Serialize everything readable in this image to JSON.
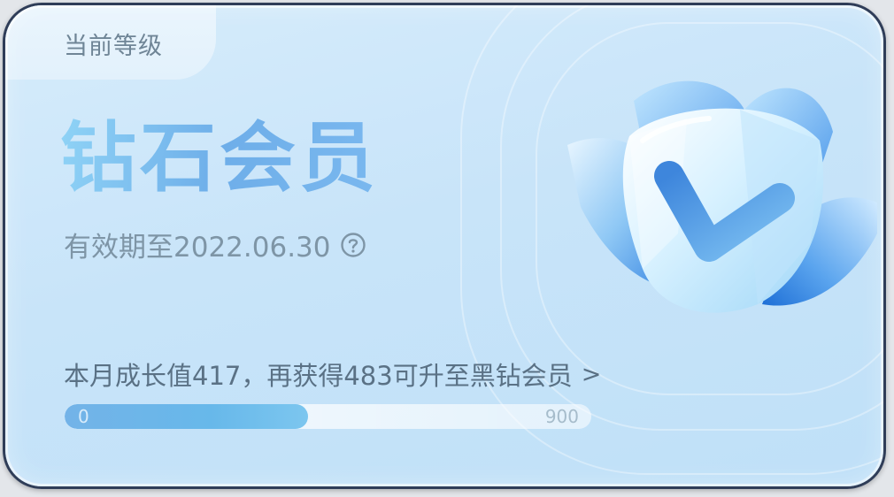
{
  "card": {
    "level_label": "当前等级",
    "tier_name": "钻石会员",
    "validity": "有效期至2022.06.30",
    "help_icon": "question-circle-icon",
    "growth_text": "本月成长值417，再获得483可升至黑钻会员",
    "growth_arrow": ">",
    "progress": {
      "current": 417,
      "min_label": "0",
      "max_label": "900",
      "fill_fraction": 0.463
    },
    "badge_icon": "diamond-check-badge-icon"
  },
  "colors": {
    "card_bg": "#c8e4f9",
    "border": "#2f3d58",
    "title_gradient_start": "#8fd3f6",
    "title_gradient_end": "#6eaee9",
    "progress_fill": "#67b8ea",
    "text_muted": "#7e95a6"
  }
}
